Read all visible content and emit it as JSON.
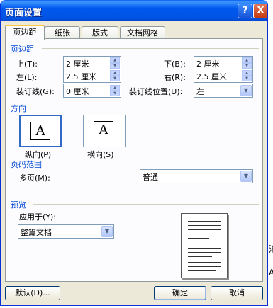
{
  "window": {
    "title": "页面设置"
  },
  "titlebar": {
    "help": "?",
    "close": "X"
  },
  "tabs": [
    "页边距",
    "纸张",
    "版式",
    "文档网格"
  ],
  "margins": {
    "section": "页边距",
    "top_label": "上(T):",
    "top_value": "2 厘米",
    "bottom_label": "下(B):",
    "bottom_value": "2 厘米",
    "left_label": "左(L):",
    "left_value": "2.5 厘米",
    "right_label": "右(R):",
    "right_value": "2.5 厘米",
    "gutter_label": "装订线(G):",
    "gutter_value": "0 厘米",
    "gutter_pos_label": "装订线位置(U):",
    "gutter_pos_value": "左"
  },
  "orientation": {
    "section": "方向",
    "glyph": "A",
    "portrait": "纵向(P)",
    "landscape": "横向(S)"
  },
  "pages": {
    "section": "页码范围",
    "multi_label": "多页(M):",
    "multi_value": "普通"
  },
  "preview": {
    "section": "预览",
    "apply_label": "应用于(Y):",
    "apply_value": "整篇文档"
  },
  "buttons": {
    "default": "默认(D)...",
    "ok": "确定",
    "cancel": "取消"
  },
  "side_text": [
    "消",
    "A"
  ]
}
